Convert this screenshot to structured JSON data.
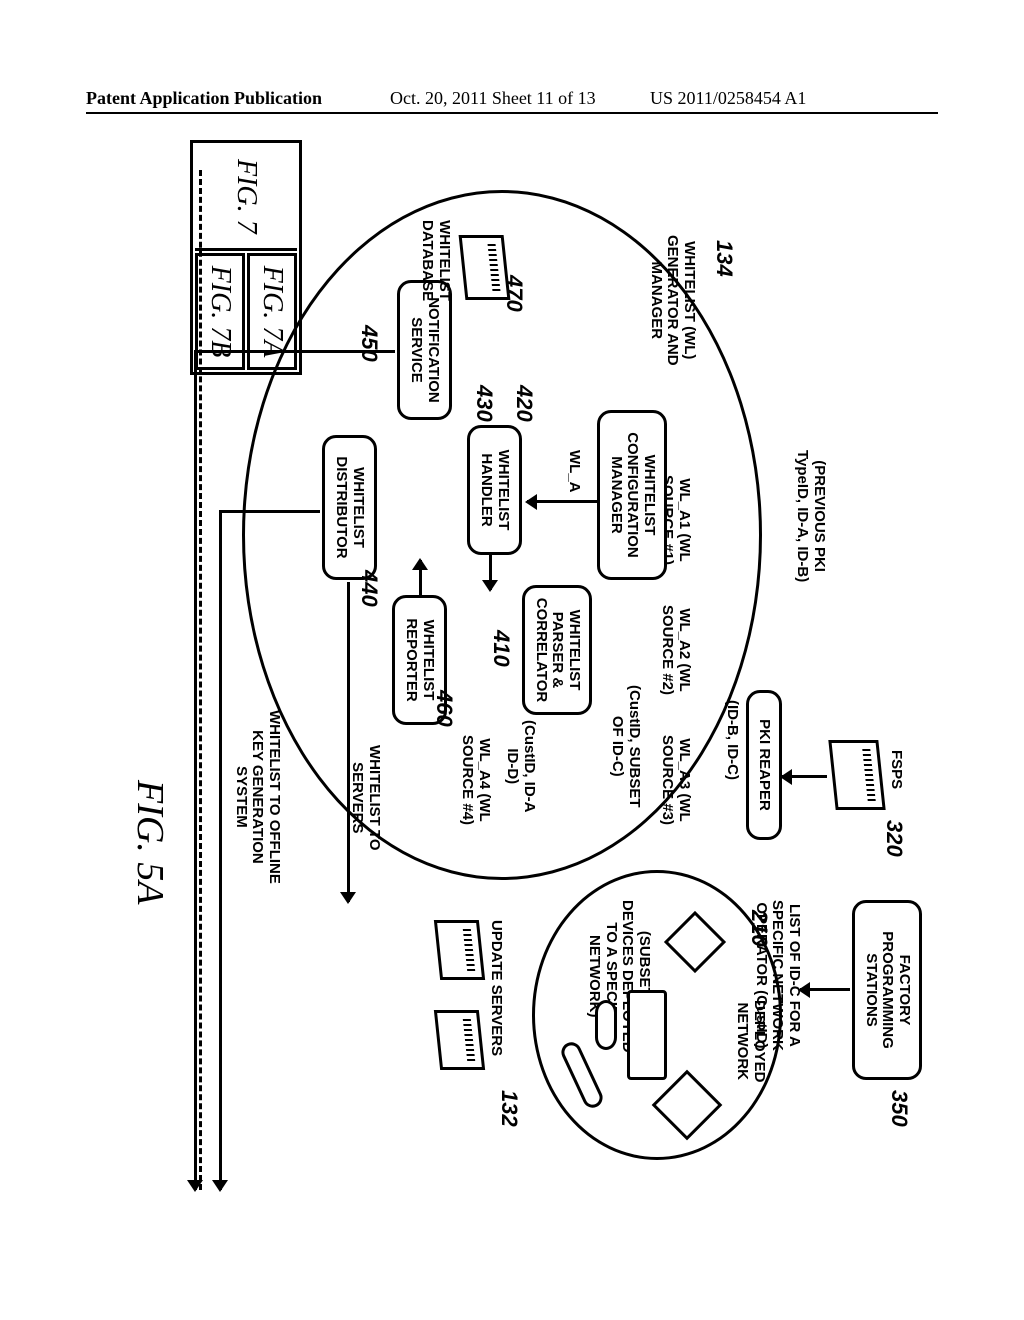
{
  "header": {
    "left": "Patent Application Publication",
    "center": "Oct. 20, 2011  Sheet 11 of 13",
    "right": "US 2011/0258454 A1"
  },
  "figure": {
    "title": "FIG. 5A",
    "key_fig": "FIG. 7",
    "key_a": "FIG. 7A",
    "key_b": "FIG. 7B"
  },
  "refs": {
    "r134": "134",
    "r320": "320",
    "r350": "350",
    "r210": "210",
    "r132": "132",
    "r410": "410",
    "r420": "420",
    "r430": "430",
    "r440": "440",
    "r450": "450",
    "r460": "460",
    "r470": "470"
  },
  "nodes": {
    "fps": "FACTORY\nPROGRAMMING\nSTATIONS",
    "fsps": "FSPS",
    "reaper": "PKI REAPER",
    "wgm": "WHITELIST (WL)\nGENERATOR AND\nMANAGER",
    "wcm": "WHITELIST\nCONFIGURATION\nMANAGER",
    "wh": "WHITELIST\nHANDLER",
    "wpc": "WHITELIST\nPARSER &\nCORRELATOR",
    "wr": "WHITELIST\nREPORTER",
    "wd": "WHITELIST\nDISTRIBUTOR",
    "ns": "NOTIFICATION\nSERVICE",
    "wdb": "WHITELIST\nDATABASE",
    "update": "UPDATE SERVERS",
    "deployed": "DEPLOYED\nNETWORK"
  },
  "edges": {
    "prev_pki": "(PREVIOUS PKI\nTypeID, ID-A, ID-B)",
    "idbc": "(ID-B, ID-C)",
    "wl_a": "WL_A",
    "wl_a1": "WL_A1 (WL\nSOURCE #1)",
    "wl_a2": "WL_A2 (WL\nSOURCE #2)",
    "wl_a3": "WL_A3 (WL\nSOURCE #3)",
    "wl_a4": "WL_A4 (WL\nSOURCE #4)",
    "cust_sub": "(CustID, SUBSET\nOF ID-C)",
    "cust_ida": "(CustID, ID-A\nID-D)",
    "list_idc": "LIST OF ID-C FOR A\nSPECIFIC NETWORK\nOPERATOR (CustID)",
    "subset": "(SUBSET OF\nDEVICES DEPLOYED\nTO A SPECIFIC\nNETWORK)",
    "to_servers": "WHITELIST TO\nSERVERS",
    "to_offline": "WHITELIST TO OFFLINE\nKEY GENERATION\nSYSTEM"
  }
}
